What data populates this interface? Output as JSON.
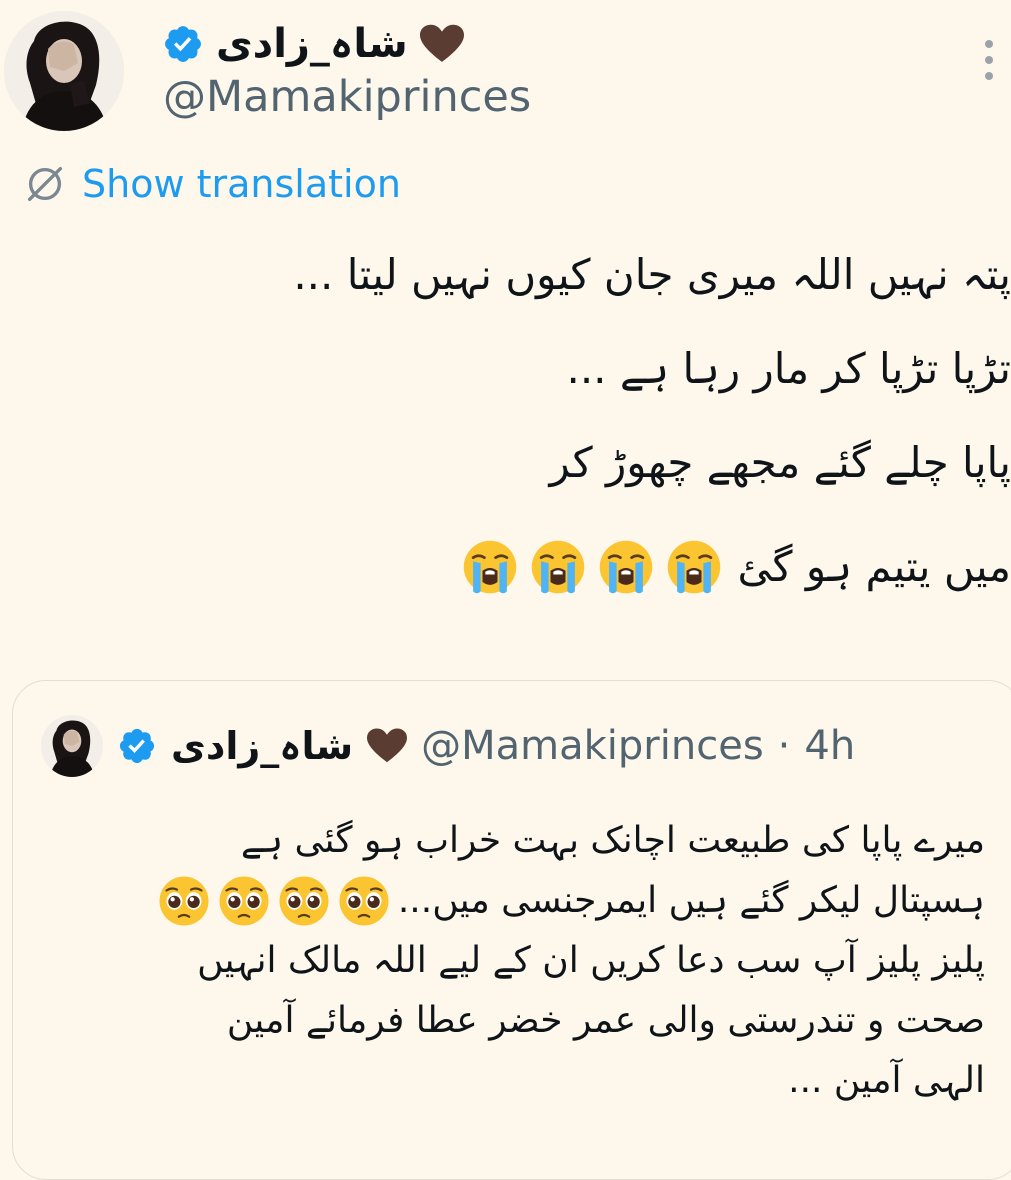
{
  "author": {
    "display_name": "شاہ_زادی",
    "handle": "@Mamakiprinces",
    "verified": true,
    "name_emoji": "brown-heart"
  },
  "translation": {
    "label": "Show translation"
  },
  "tweet": {
    "lines": [
      "پتہ نہیں اللہ میری جان کیوں نہیں لیتا ...",
      "تڑپا تڑپا کر مار رہا ہے ...",
      "پاپا چلے گئے مجھے چھوڑ کر",
      "میں یتیم ہو گئ"
    ],
    "emojis": [
      "loudly-crying-face",
      "loudly-crying-face",
      "loudly-crying-face",
      "loudly-crying-face"
    ]
  },
  "quoted_tweet": {
    "display_name": "شاہ_زادی",
    "handle": "@Mamakiprinces",
    "separator": "·",
    "time": "4h",
    "verified": true,
    "lines": [
      "میرے پاپا کی طبیعت اچانک بہت خراب ہو گئی ہے",
      "ہسپتال لیکر گئے ہیں ایمرجنسی میں...",
      "پلیز پلیز آپ سب دعا کریں ان کے لیے اللہ مالک انہیں",
      "صحت و تندرستی والی عمر خضر عطا فرمائے آمین",
      "الہی آمین ..."
    ],
    "line2_emojis": [
      "pleading-face",
      "pleading-face",
      "pleading-face",
      "pleading-face"
    ]
  },
  "colors": {
    "background": "#fdf7ec",
    "text": "#0f1419",
    "secondary_text": "#536471",
    "link": "#1d9bf0",
    "verified_badge": "#1d9bf0"
  }
}
